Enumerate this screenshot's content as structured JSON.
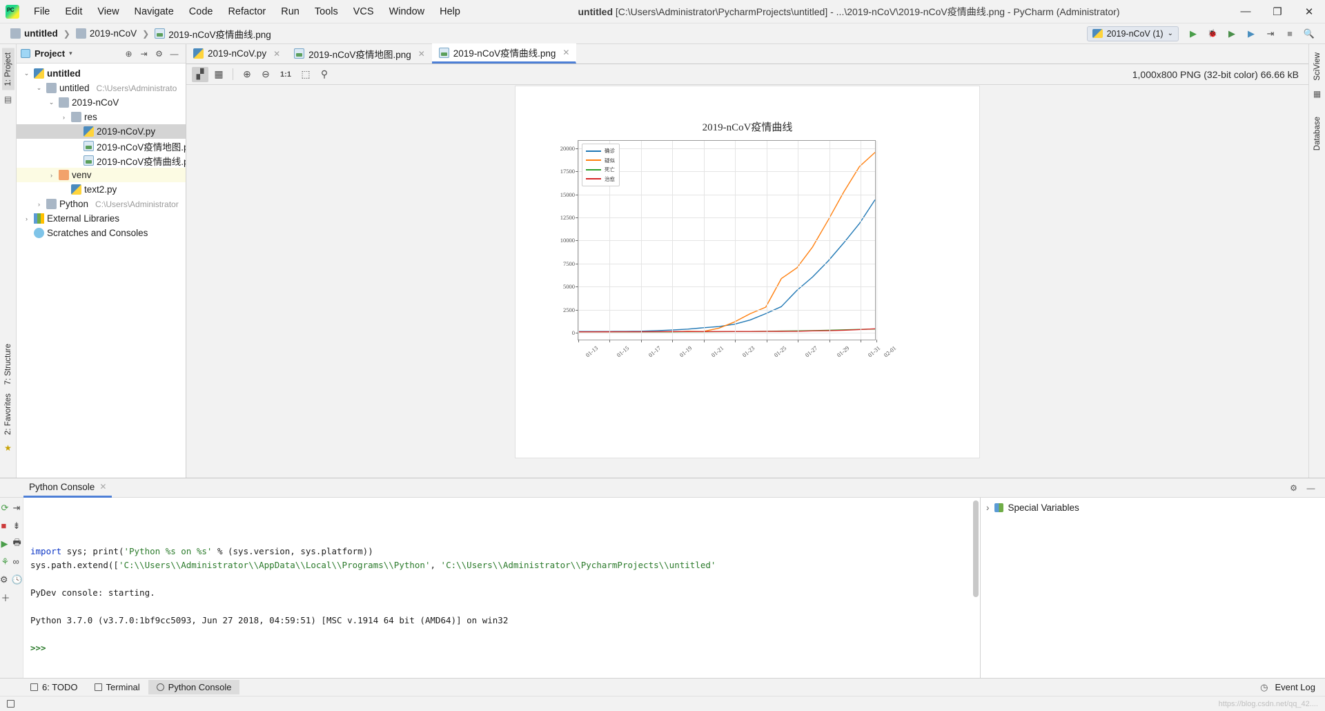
{
  "window": {
    "title_bold": "untitled",
    "title_rest": " [C:\\Users\\Administrator\\PycharmProjects\\untitled] - ...\\2019-nCoV\\2019-nCoV疫情曲线.png - PyCharm (Administrator)",
    "minimize": "—",
    "maximize": "❐",
    "close": "✕"
  },
  "menu": [
    {
      "label": "File"
    },
    {
      "label": "Edit"
    },
    {
      "label": "View"
    },
    {
      "label": "Navigate"
    },
    {
      "label": "Code"
    },
    {
      "label": "Refactor"
    },
    {
      "label": "Run"
    },
    {
      "label": "Tools"
    },
    {
      "label": "VCS"
    },
    {
      "label": "Window"
    },
    {
      "label": "Help"
    }
  ],
  "breadcrumb": [
    {
      "label": "untitled",
      "icon": "folder-icon"
    },
    {
      "label": "2019-nCoV",
      "icon": "folder-icon"
    },
    {
      "label": "2019-nCoV疫情曲线.png",
      "icon": "image-file-icon"
    }
  ],
  "toolbar": {
    "run_config": "2019-nCoV (1)",
    "run_config_caret": "⌄",
    "run": "▶",
    "debug": "🐞",
    "coverage": "▶",
    "profile": "▶",
    "attach": "⇥",
    "stop": "■",
    "search": "🔍"
  },
  "project_panel": {
    "title": "Project",
    "caret": "▾",
    "locate_icon": "⊕",
    "collapse_icon": "⇥",
    "settings_icon": "⚙",
    "hide_icon": "—",
    "tree": [
      {
        "label": "untitled",
        "path": "",
        "depth": 0,
        "arrow": "⌄",
        "icon": "project-icon",
        "bold": true,
        "state": "normal"
      },
      {
        "label": "untitled",
        "path": "C:\\Users\\Administrato",
        "depth": 1,
        "arrow": "⌄",
        "icon": "folder-icon",
        "bold": false,
        "state": "normal"
      },
      {
        "label": "2019-nCoV",
        "path": "",
        "depth": 2,
        "arrow": "⌄",
        "icon": "folder-icon",
        "bold": false,
        "state": "normal"
      },
      {
        "label": "res",
        "path": "",
        "depth": 3,
        "arrow": "›",
        "icon": "folder-icon",
        "bold": false,
        "state": "normal"
      },
      {
        "label": "2019-nCoV.py",
        "path": "",
        "depth": 4,
        "arrow": "",
        "icon": "python-file-icon",
        "bold": false,
        "state": "selected"
      },
      {
        "label": "2019-nCoV疫情地图.png",
        "path": "",
        "depth": 4,
        "arrow": "",
        "icon": "image-file-icon",
        "bold": false,
        "state": "normal"
      },
      {
        "label": "2019-nCoV疫情曲线.png",
        "path": "",
        "depth": 4,
        "arrow": "",
        "icon": "image-file-icon",
        "bold": false,
        "state": "normal"
      },
      {
        "label": "venv",
        "path": "",
        "depth": 2,
        "arrow": "›",
        "icon": "folder-orange-icon",
        "bold": false,
        "state": "highlight"
      },
      {
        "label": "text2.py",
        "path": "",
        "depth": 3,
        "arrow": "",
        "icon": "python-file-icon",
        "bold": false,
        "state": "normal"
      },
      {
        "label": "Python",
        "path": "C:\\Users\\Administrator",
        "depth": 1,
        "arrow": "›",
        "icon": "folder-icon",
        "bold": false,
        "state": "normal"
      },
      {
        "label": "External Libraries",
        "path": "",
        "depth": 0,
        "arrow": "›",
        "icon": "library-icon",
        "bold": false,
        "state": "normal"
      },
      {
        "label": "Scratches and Consoles",
        "path": "",
        "depth": 0,
        "arrow": "",
        "icon": "scratch-icon",
        "bold": false,
        "state": "normal"
      }
    ]
  },
  "editor_tabs": [
    {
      "label": "2019-nCoV.py",
      "icon": "python-file-icon",
      "active": false,
      "close": "✕"
    },
    {
      "label": "2019-nCoV疫情地图.png",
      "icon": "image-file-icon",
      "active": false,
      "close": "✕"
    },
    {
      "label": "2019-nCoV疫情曲线.png",
      "icon": "image-file-icon",
      "active": true,
      "close": "✕"
    }
  ],
  "image_toolbar": {
    "buttons": [
      {
        "name": "toggle-transparency-chessboard",
        "glyph": "▞",
        "active": true
      },
      {
        "name": "toggle-grid",
        "glyph": "▦",
        "active": false
      },
      {
        "name": "zoom-in",
        "glyph": "⊕",
        "active": false
      },
      {
        "name": "zoom-out",
        "glyph": "⊖",
        "active": false
      },
      {
        "name": "actual-size",
        "glyph": "1:1",
        "active": false
      },
      {
        "name": "fit-to-window",
        "glyph": "⬚",
        "active": false
      },
      {
        "name": "color-picker",
        "glyph": "⚲",
        "active": false
      }
    ],
    "info": "1,000x800 PNG (32-bit color) 66.66 kB"
  },
  "chart_data": {
    "type": "line",
    "title": "2019-nCoV疫情曲线",
    "xlabel": "",
    "ylabel": "",
    "ylim": [
      -900,
      20800
    ],
    "grid": true,
    "legend_position": "upper left",
    "x": [
      "01-13",
      "01-14",
      "01-15",
      "01-16",
      "01-17",
      "01-18",
      "01-19",
      "01-20",
      "01-21",
      "01-22",
      "01-23",
      "01-24",
      "01-25",
      "01-26",
      "01-27",
      "01-28",
      "01-29",
      "01-30",
      "01-31",
      "02-01"
    ],
    "xticks": [
      "01-13",
      "01-15",
      "01-17",
      "01-19",
      "01-21",
      "01-23",
      "01-25",
      "01-27",
      "01-29",
      "01-31",
      "02-01"
    ],
    "yticks": [
      0,
      2500,
      5000,
      7500,
      10000,
      12500,
      15000,
      17500,
      20000
    ],
    "series": [
      {
        "name": "确诊",
        "color": "#1f77b4",
        "values": [
          41,
          41,
          41,
          45,
          62,
          121,
          198,
          291,
          440,
          571,
          830,
          1287,
          1975,
          2744,
          4515,
          5974,
          7711,
          9692,
          11791,
          14380
        ]
      },
      {
        "name": "疑似",
        "color": "#ff7f0e",
        "values": [
          0,
          0,
          0,
          0,
          0,
          0,
          0,
          54,
          37,
          393,
          1072,
          1965,
          2684,
          5794,
          6973,
          9239,
          12167,
          15238,
          17988,
          19544
        ]
      },
      {
        "name": "死亡",
        "color": "#2ca02c",
        "values": [
          1,
          1,
          2,
          2,
          2,
          3,
          3,
          6,
          9,
          17,
          25,
          41,
          56,
          80,
          106,
          132,
          170,
          213,
          259,
          304
        ]
      },
      {
        "name": "治愈",
        "color": "#d62728",
        "values": [
          0,
          0,
          5,
          8,
          12,
          15,
          25,
          25,
          25,
          28,
          34,
          38,
          49,
          51,
          60,
          103,
          124,
          171,
          243,
          328
        ]
      }
    ]
  },
  "console": {
    "tab_label": "Python Console",
    "tab_close": "✕",
    "settings_icon": "⚙",
    "hide_icon": "—",
    "lines": [
      {
        "segments": [
          {
            "t": "import",
            "c": "kw"
          },
          {
            "t": " sys; ",
            "c": "plain"
          },
          {
            "t": "print",
            "c": "plain"
          },
          {
            "t": "(",
            "c": "plain"
          },
          {
            "t": "'Python %s on %s'",
            "c": "str"
          },
          {
            "t": " % (sys.version, sys.platform))",
            "c": "plain"
          }
        ]
      },
      {
        "segments": [
          {
            "t": "sys.path.extend([",
            "c": "plain"
          },
          {
            "t": "'C:\\\\Users\\\\Administrator\\\\AppData\\\\Local\\\\Programs\\\\Python'",
            "c": "str"
          },
          {
            "t": ", ",
            "c": "plain"
          },
          {
            "t": "'C:\\\\Users\\\\Administrator\\\\PycharmProjects\\\\untitled'",
            "c": "str"
          }
        ]
      },
      {
        "segments": [
          {
            "t": "",
            "c": "plain"
          }
        ]
      },
      {
        "segments": [
          {
            "t": "PyDev console: starting.",
            "c": "plain"
          }
        ]
      },
      {
        "segments": [
          {
            "t": "",
            "c": "plain"
          }
        ]
      },
      {
        "segments": [
          {
            "t": "Python 3.7.0 (v3.7.0:1bf9cc5093, Jun 27 2018, 04:59:51) [MSC v.1914 64 bit (AMD64)] on win32",
            "c": "plain"
          }
        ]
      },
      {
        "segments": [
          {
            "t": "",
            "c": "plain"
          }
        ]
      },
      {
        "segments": [
          {
            "t": ">>>",
            "c": "prompt"
          }
        ]
      }
    ],
    "gutter_icons": [
      {
        "name": "rerun-icon",
        "glyph": "⟳",
        "color": "green"
      },
      {
        "name": "stop-icon",
        "glyph": "■",
        "color": "red"
      },
      {
        "name": "execute-icon",
        "glyph": "▶",
        "color": "green"
      },
      {
        "name": "attach-debugger-icon",
        "glyph": "⚘",
        "color": "green"
      },
      {
        "name": "settings-icon",
        "glyph": "⚙",
        "color": "plain"
      },
      {
        "name": "add-icon",
        "glyph": "＋",
        "color": "plain"
      }
    ],
    "gutter_icons_right": [
      {
        "name": "soft-wrap-icon",
        "glyph": "⇥"
      },
      {
        "name": "scroll-to-end-icon",
        "glyph": "⇟"
      },
      {
        "name": "print-icon",
        "glyph": "🖶"
      },
      {
        "name": "link-icon",
        "glyph": "∞"
      },
      {
        "name": "history-icon",
        "glyph": "🕓"
      }
    ]
  },
  "variables": {
    "header": "Special Variables",
    "expander": "›"
  },
  "statusbar": {
    "items": [
      {
        "name": "todo",
        "label": "6: TODO",
        "icon": "list-icon",
        "selected": false
      },
      {
        "name": "terminal",
        "label": "Terminal",
        "icon": "terminal-icon",
        "selected": false
      },
      {
        "name": "python-console",
        "label": "Python Console",
        "icon": "console-icon",
        "selected": true
      }
    ],
    "event_log": "Event Log",
    "event_log_icon": "◷",
    "watermark": "https://blog.csdn.net/qq_42...."
  },
  "left_strip": {
    "project_tab": "1: Project",
    "structure_tab": "7: Structure",
    "favorites_tab": "2: Favorites",
    "star_icon": "★"
  },
  "right_strip": {
    "sciview_tab": "SciView",
    "database_tab": "Database"
  }
}
